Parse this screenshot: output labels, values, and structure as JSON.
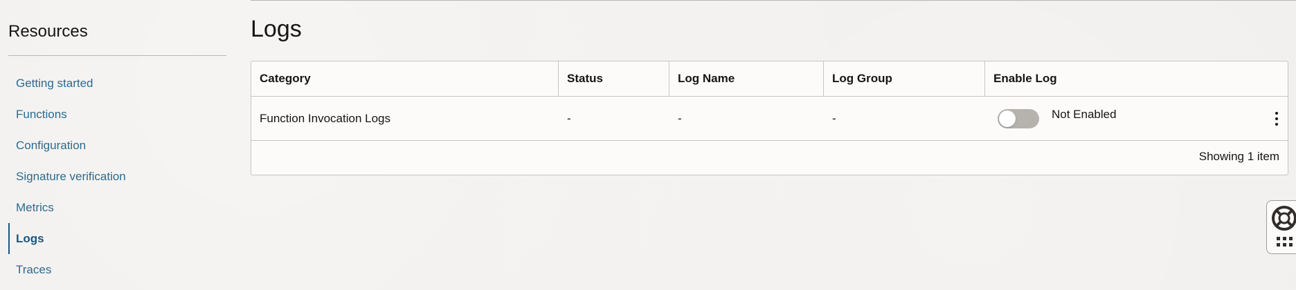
{
  "sidebar": {
    "title": "Resources",
    "items": [
      {
        "label": "Getting started",
        "active": false
      },
      {
        "label": "Functions",
        "active": false
      },
      {
        "label": "Configuration",
        "active": false
      },
      {
        "label": "Signature verification",
        "active": false
      },
      {
        "label": "Metrics",
        "active": false
      },
      {
        "label": "Logs",
        "active": true
      },
      {
        "label": "Traces",
        "active": false
      }
    ]
  },
  "main": {
    "title": "Logs",
    "table": {
      "columns": [
        "Category",
        "Status",
        "Log Name",
        "Log Group",
        "Enable Log"
      ],
      "rows": [
        {
          "category": "Function Invocation Logs",
          "status": "-",
          "log_name": "-",
          "log_group": "-",
          "enable_log": {
            "enabled": false,
            "label": "Not Enabled"
          }
        }
      ],
      "footer": "Showing 1 item"
    }
  },
  "icons": {
    "row_actions": "kebab-menu-icon",
    "help": "lifebuoy-icon",
    "apps": "grid-icon"
  },
  "colors": {
    "link": "#2c6a8e",
    "active_link": "#1c5580",
    "toggle_off": "#b6b2ad"
  }
}
